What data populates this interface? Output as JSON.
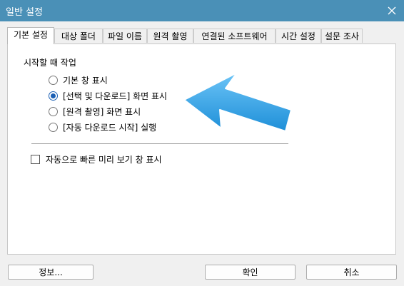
{
  "window": {
    "title": "일반 설정"
  },
  "tabs": [
    {
      "label": "기본 설정",
      "active": true
    },
    {
      "label": "대상 폴더",
      "active": false
    },
    {
      "label": "파일 이름",
      "active": false
    },
    {
      "label": "원격 촬영",
      "active": false
    },
    {
      "label": "연결된 소프트웨어",
      "active": false
    },
    {
      "label": "시간 설정",
      "active": false
    },
    {
      "label": "설문 조사",
      "active": false
    }
  ],
  "startup": {
    "group_label": "시작할 때 작업",
    "options": [
      {
        "label": "기본 창 표시",
        "selected": false
      },
      {
        "label": "[선택 및 다운로드] 화면 표시",
        "selected": true
      },
      {
        "label": "[원격 촬영] 화면 표시",
        "selected": false
      },
      {
        "label": "[자동 다운로드 시작] 실행",
        "selected": false
      }
    ]
  },
  "quick_preview": {
    "label": "자동으로 빠른 미리 보기 창 표시",
    "checked": false
  },
  "buttons": {
    "info": "정보...",
    "ok": "확인",
    "cancel": "취소"
  },
  "colors": {
    "titlebar": "#4a90b7",
    "arrow": "#3aa3e6",
    "accent": "#1a5fb4"
  },
  "icons": {
    "close": "close-icon",
    "annotation_arrow": "arrow-annotation-icon"
  }
}
